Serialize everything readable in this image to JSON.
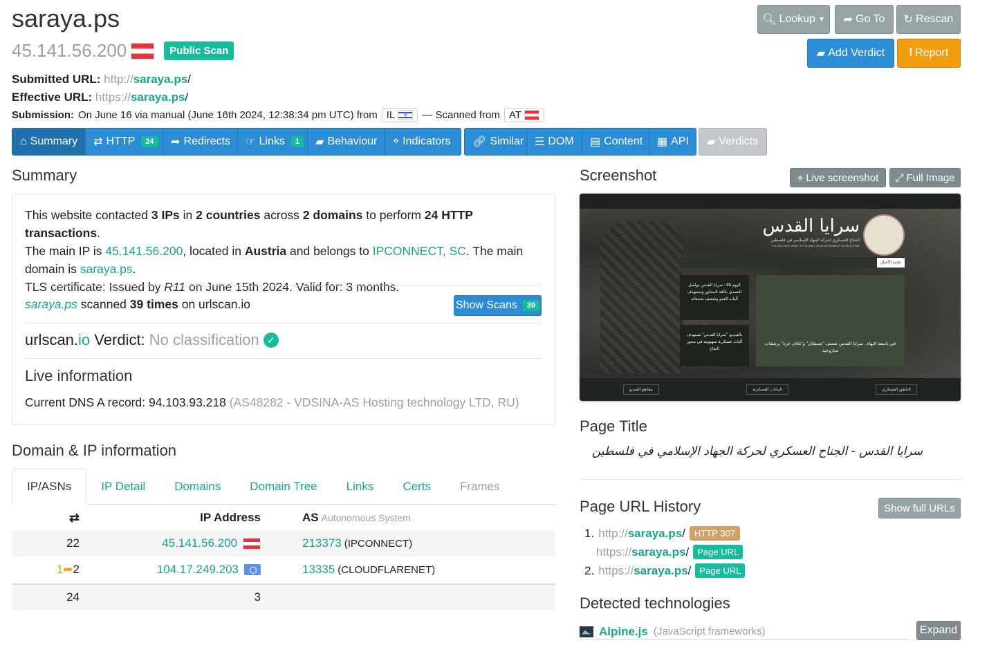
{
  "header": {
    "site": "saraya.ps",
    "ip": "45.141.56.200",
    "public_scan": "Public Scan",
    "submitted_label": "Submitted URL:",
    "submitted_scheme": "http://",
    "submitted_domain": "saraya.ps",
    "submitted_tail": "/",
    "effective_label": "Effective URL:",
    "effective_scheme": "https://",
    "effective_domain": "saraya.ps",
    "effective_tail": "/",
    "submission_label": "Submission:",
    "submission_text": "On June 16 via manual (June 16th 2024, 12:38:34 pm UTC) from",
    "from_country": "IL",
    "scanned_from_text": "— Scanned from",
    "scanned_country": "AT"
  },
  "actions": {
    "lookup": "Lookup",
    "goto": "Go To",
    "rescan": "Rescan",
    "add_verdict": "Add Verdict",
    "report": "Report"
  },
  "nav": {
    "summary": "Summary",
    "http": "HTTP",
    "http_count": "24",
    "redirects": "Redirects",
    "links": "Links",
    "links_count": "1",
    "behaviour": "Behaviour",
    "indicators": "Indicators",
    "similar": "Similar",
    "dom": "DOM",
    "content": "Content",
    "api": "API",
    "verdicts": "Verdicts"
  },
  "summary": {
    "heading": "Summary",
    "p1": "This website contacted",
    "ips": "3 IPs",
    "p2": "in",
    "countries": "2 countries",
    "p3": "across",
    "domains": "2 domains",
    "p4": "to perform",
    "transactions": "24 HTTP transactions",
    "p5": ".",
    "main_ip_text": "The main IP is",
    "main_ip": "45.141.56.200",
    "located_text": ", located in",
    "country": "Austria",
    "belongs_text": "and belongs to",
    "asn_name": "IPCONNECT, SC",
    "main_domain_text": ". The main domain is",
    "main_domain": "saraya.ps",
    "tls_text": "TLS certificate: Issued by",
    "tls_issuer": "R11",
    "tls_rest": "on June 15th 2024. Valid for: 3 months.",
    "scanned_domain": "saraya.ps",
    "scanned_text": "scanned",
    "scanned_times": "39 times",
    "scanned_on": "on urlscan.io",
    "show_scans": "Show Scans",
    "show_scans_count": "39",
    "verdict_brand_a": "urlscan.",
    "verdict_brand_b": "io",
    "verdict_label": "Verdict:",
    "verdict_value": "No classification",
    "live_heading": "Live information",
    "dns_text": "Current DNS A record: 94.103.93.218",
    "dns_asn": "(AS48282 - VDSINA-AS Hosting technology LTD, RU)"
  },
  "domain_ip": {
    "heading": "Domain & IP information",
    "tabs": [
      "IP/ASNs",
      "IP Detail",
      "Domains",
      "Domain Tree",
      "Links",
      "Certs",
      "Frames"
    ],
    "col_ip": "IP Address",
    "col_as": "AS",
    "col_as_sub": "Autonomous System",
    "rows": [
      {
        "count": "22",
        "redirect": "",
        "ip": "45.141.56.200",
        "flag": "at",
        "asn": "213373",
        "asn_name": "(IPCONNECT)"
      },
      {
        "count": "2",
        "redirect": "1",
        "ip": "104.17.249.203",
        "flag": "un",
        "asn": "13335",
        "asn_name": "(CLOUDFLARENET)"
      }
    ],
    "total_requests": "24",
    "total_ips": "3"
  },
  "screenshot": {
    "heading": "Screenshot",
    "live_button": "Live screenshot",
    "full_button": "Full Image",
    "brand_script": "سرايا القدس",
    "brand_sub": "الجناح العسكري لحركة الجهاد الإسلامي في فلسطين",
    "brand_en": "THE MILITARY WING OF ISLAMIC JIHAD MOVEMENT IN PALESTINE",
    "news_btn": "جديد الأخبار",
    "card1": "اليوم 89 : سرايا القدس تواصل التصدي بكافة المحاور وتستهدف آليات العدو وتقصف تجمعاته",
    "card2": "بالفيديو: \"سرايا القدس\" تستهدف آليات عسكرية صهيونية في محور النقاح",
    "card3": "في ناسعة البهاء.. سرايا القدس تقصف \"عسقلان\" و\"غلاف غزة\" برشقات صاروخية",
    "footer": [
      "مقاطع الفيديو",
      "البيانات العسكرية",
      "الناطق العسكري"
    ]
  },
  "page_title": {
    "heading": "Page Title",
    "value": "سرايا القدس - الجناح العسكري لحركة الجهاد الإسلامي في فلسطين"
  },
  "url_history": {
    "heading": "Page URL History",
    "button": "Show full URLs",
    "items": [
      {
        "num": "1.",
        "scheme": "http://",
        "domain": "saraya.ps",
        "tail": "/",
        "badge": "HTTP 307"
      },
      {
        "num": "",
        "scheme": "https://",
        "domain": "saraya.ps",
        "tail": "/",
        "badge": "Page URL"
      },
      {
        "num": "2.",
        "scheme": "https://",
        "domain": "saraya.ps",
        "tail": "/",
        "badge": "Page URL"
      }
    ]
  },
  "tech": {
    "heading": "Detected technologies",
    "name": "Alpine.js",
    "category": "(JavaScript frameworks)",
    "expand": "Expand"
  }
}
